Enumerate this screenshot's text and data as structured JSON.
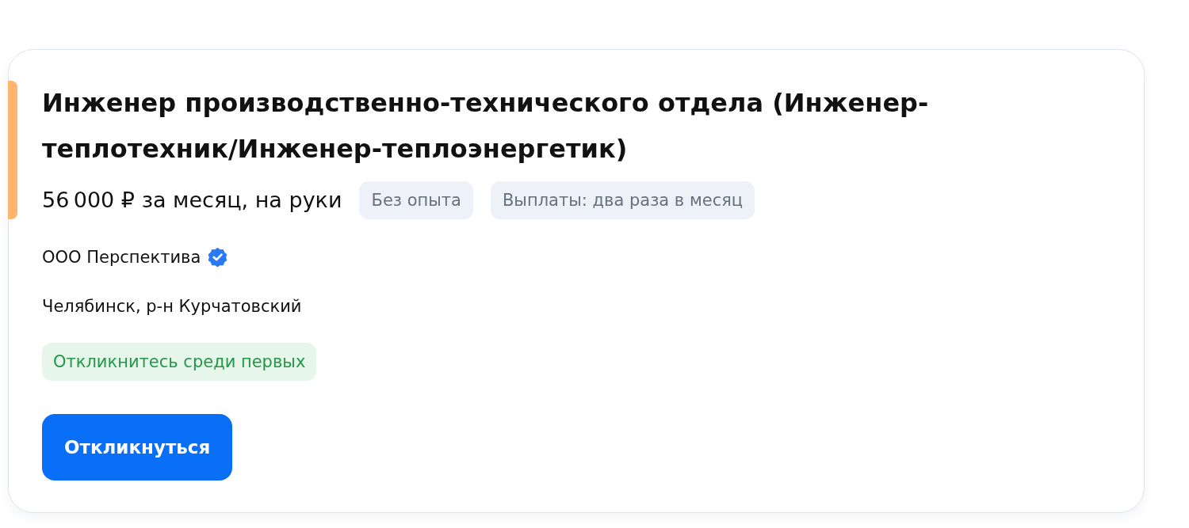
{
  "vacancy": {
    "highlighted": true,
    "title": "Инженер производственно-технического отдела (Инженер-теплотехник/Инженер-теплоэнергетик)",
    "salary": "56 000 ₽ за месяц, на руки",
    "tags": [
      "Без опыта",
      "Выплаты: два раза в месяц"
    ],
    "company": {
      "name": "ООО Перспектива",
      "verified": true
    },
    "location": "Челябинск, р-н Курчатовский",
    "badge": "Откликнитесь среди первых",
    "apply_button": "Откликнуться"
  }
}
